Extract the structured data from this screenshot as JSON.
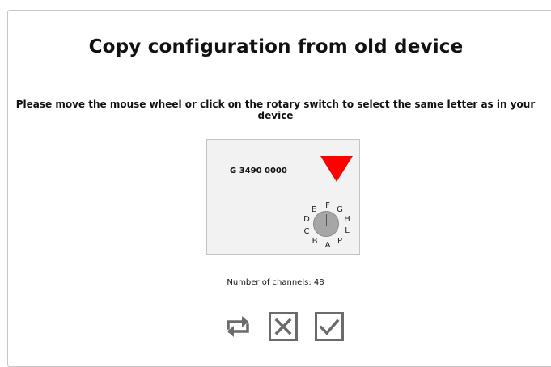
{
  "title": "Copy configuration from old device",
  "instruction": "Please move the mouse wheel or click on the rotary switch to select the same letter as in your device",
  "device": {
    "label": "G 3490 0000",
    "selected_letter": "F",
    "letters": [
      "F",
      "G",
      "H",
      "L",
      "P",
      "A",
      "B",
      "C",
      "D",
      "E"
    ]
  },
  "channels_text": "Number of channels: 48",
  "actions": {
    "retry_icon": "swap-arrows-icon",
    "cancel_icon": "close-box-icon",
    "confirm_icon": "checkbox-checked-icon"
  },
  "colors": {
    "marker": "#ff0000",
    "icon": "#6b6b6b"
  }
}
